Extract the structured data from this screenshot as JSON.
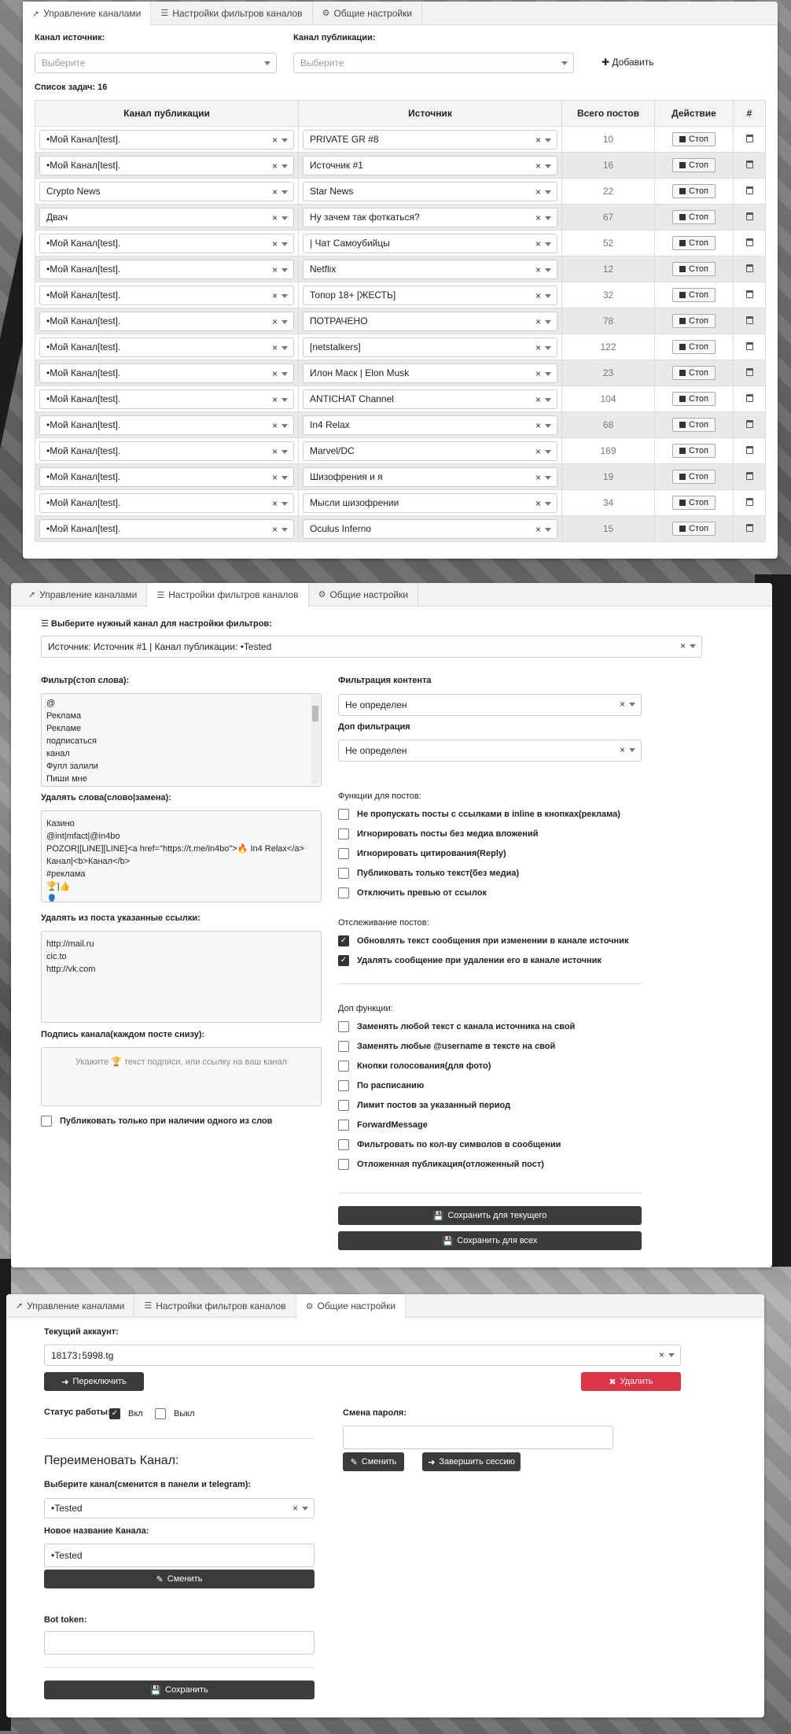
{
  "tabs": [
    {
      "icon": "paper-plane-icon",
      "label": "Управление каналами"
    },
    {
      "icon": "list-icon",
      "label": "Настройки фильтров каналов"
    },
    {
      "icon": "gears-icon",
      "label": "Общие настройки"
    }
  ],
  "manage": {
    "source_label": "Канал источник:",
    "source_placeholder": "Выберите",
    "pub_label": "Канал публикации:",
    "pub_placeholder": "Выберите",
    "add_label": "Добавить",
    "task_list_label": "Список задач: 16",
    "columns": [
      "Канал публикации",
      "Источник",
      "Всего постов",
      "Действие",
      "#"
    ],
    "stop_label": "Стоп",
    "rows": [
      {
        "pub": "•Мой Канал[test].",
        "source": "PRIVATE GR #8",
        "posts": "10"
      },
      {
        "pub": "•Мой Канал[test].",
        "source": "Источник #1",
        "posts": "16"
      },
      {
        "pub": "Crypto News",
        "source": "Star News",
        "posts": "22"
      },
      {
        "pub": "Двач",
        "source": "Ну зачем так фоткаться?",
        "posts": "67"
      },
      {
        "pub": "•Мой Канал[test].",
        "source": "| Чат Самоубийцы",
        "posts": "52"
      },
      {
        "pub": "•Мой Канал[test].",
        "source": "Netflix",
        "posts": "12"
      },
      {
        "pub": "•Мой Канал[test].",
        "source": "Топор 18+ [ЖЕСТЬ]",
        "posts": "32"
      },
      {
        "pub": "•Мой Канал[test].",
        "source": "ПОТРАЧЕНО",
        "posts": "78"
      },
      {
        "pub": "•Мой Канал[test].",
        "source": "[netstalkers]",
        "posts": "122"
      },
      {
        "pub": "•Мой Канал[test].",
        "source": "Илон Маск | Elon Musk",
        "posts": "23"
      },
      {
        "pub": "•Мой Канал[test].",
        "source": "ANTICHAT Channel",
        "posts": "104"
      },
      {
        "pub": "•Мой Канал[test].",
        "source": "In4 Relax",
        "posts": "68"
      },
      {
        "pub": "•Мой Канал[test].",
        "source": "Marvel/DC",
        "posts": "169"
      },
      {
        "pub": "•Мой Канал[test].",
        "source": "Шизофрения и я",
        "posts": "19"
      },
      {
        "pub": "•Мой Канал[test].",
        "source": "Мысли шизофрении",
        "posts": "34"
      },
      {
        "pub": "•Мой Канал[test].",
        "source": "Oculus Inferno",
        "posts": "15"
      }
    ]
  },
  "filters": {
    "choose_label": "Выберите нужный канал для настройки фильтров:",
    "choose_value": "Источник: Источник #1 | Канал публикации: •Tested",
    "stopwords_label": "Фильтр(стоп слова):",
    "stopwords": "@\nРеклама\nРекламе\nподписаться\nканал\nФулл залили\nПиши мне",
    "replace_label": "Удалять слова(слово|замена):",
    "replace": "Казино\n@int|mfact|@in4bo\nPOZOR|[LINE][LINE]<a href=\"https://t.me/in4bo\">🔥 In4 Relax</a>\nКанал|<b>Канал</b>\n#реклама\n🏆|👍\n👤",
    "links_label": "Удалять из поста указанные ссылки:",
    "links": "http://mail.ru\ncic.to\nhttp://vk.com",
    "signature_label": "Подпись канала(каждом посте снизу):",
    "signature_placeholder": "Укажите 🏆 текст подписи, или ссылку на ваш канал",
    "only_words_label": "Публиковать только при наличии одного из слов",
    "content_filter_label": "Фильтрация контента",
    "content_filter_value": "Не определен",
    "extra_filter_label": "Доп фильтрация",
    "extra_filter_value": "Не определен",
    "post_functions_label": "Функции для постов:",
    "post_functions": [
      {
        "label": "Не пропускать посты с ссылками в inline в кнопках(реклама)",
        "checked": false
      },
      {
        "label": "Игнорировать посты без медиа вложений",
        "checked": false
      },
      {
        "label": "Игнорировать цитирования(Reply)",
        "checked": false
      },
      {
        "label": "Публиковать только текст(без медиа)",
        "checked": false
      },
      {
        "label": "Отключить превью от ссылок",
        "checked": false
      }
    ],
    "tracking_label": "Отслеживание постов:",
    "tracking": [
      {
        "label": "Обновлять текст сообщения при изменении в канале источник",
        "checked": true
      },
      {
        "label": "Удалять сообщение при удалении его в канале источник",
        "checked": true
      }
    ],
    "extra_functions_label": "Доп функции:",
    "extra_functions": [
      {
        "label": "Заменять любой текст с канала источника на свой",
        "checked": false
      },
      {
        "label": "Заменять любые @username в тексте на свой",
        "checked": false
      },
      {
        "label": "Кнопки голосования(для фото)",
        "checked": false
      },
      {
        "label": "По расписанию",
        "checked": false
      },
      {
        "label": "Лимит постов за указанный период",
        "checked": false
      },
      {
        "label": "ForwardMessage",
        "checked": false
      },
      {
        "label": "Фильтровать по кол-ву символов в сообщении",
        "checked": false
      },
      {
        "label": "Отложенная публикация(отложенный пост)",
        "checked": false
      }
    ],
    "save_current": "Сохранить для текущего",
    "save_all": "Сохранить для всех"
  },
  "general": {
    "account_label": "Текущий аккаунт:",
    "account_value": "18173↕5998.tg",
    "switch_label": "Переключить",
    "delete_label": "Удалить",
    "status_label": "Статус работы:",
    "on_label": "Вкл",
    "off_label": "Выкл",
    "rename_title": "Переименовать Канал:",
    "choose_channel_label": "Выберите канал(сменится в панели и telegram):",
    "channel_value": "•Tested",
    "new_name_label": "Новое название Канала:",
    "new_name_value": "•Tested",
    "change_label": "Сменить",
    "bot_token_label": "Bot token:",
    "save_label": "Сохранить",
    "password_label": "Смена пароля:",
    "pw_change_label": "Сменить",
    "end_session_label": "Завершить сессию"
  },
  "colors": {
    "accent_dark": "#3b3b3b",
    "danger": "#dc3545"
  }
}
